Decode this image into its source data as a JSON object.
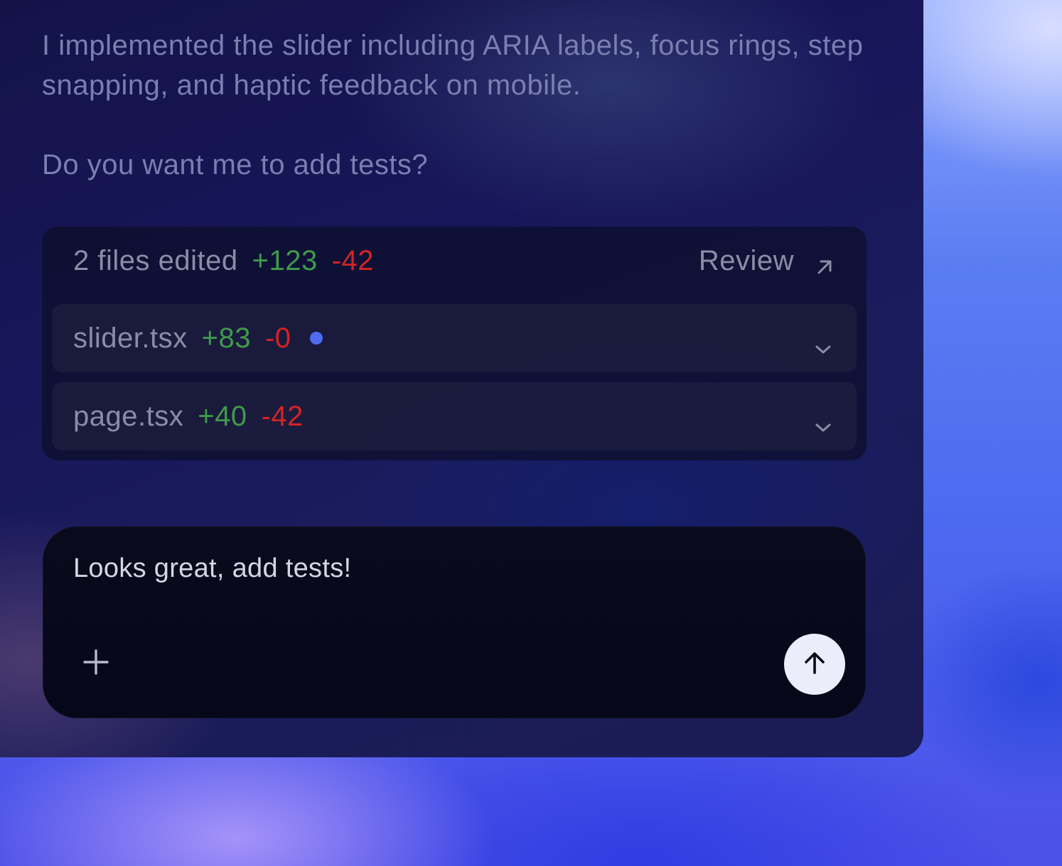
{
  "message": {
    "paragraph1": "I implemented the slider including ARIA labels, focus rings, step snapping, and haptic feedback on mobile.",
    "paragraph2": "Do you want me to add tests?"
  },
  "files_summary": {
    "label": "2 files edited",
    "additions": "+123",
    "deletions": "-42",
    "review_label": "Review",
    "review_icon": "arrow-up-right-icon"
  },
  "files": [
    {
      "name": "slider.tsx",
      "additions": "+83",
      "deletions": "-0",
      "unsaved_indicator": true,
      "icon": "chevron-down-icon"
    },
    {
      "name": "page.tsx",
      "additions": "+40",
      "deletions": "-42",
      "unsaved_indicator": false,
      "icon": "chevron-down-icon"
    }
  ],
  "composer": {
    "value": "Looks great, add tests!",
    "attach_icon": "plus-icon",
    "send_icon": "arrow-up-icon"
  },
  "colors": {
    "additions": "#3f9a4a",
    "deletions": "#d32424",
    "indicator": "#4f6cf0",
    "send_button": "#ecedfb"
  }
}
